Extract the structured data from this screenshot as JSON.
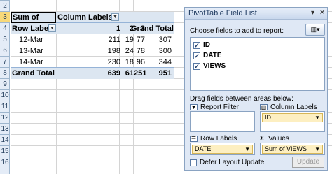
{
  "sheet": {
    "row_numbers": [
      "2",
      "3",
      "4",
      "5",
      "6",
      "7",
      "8",
      "9",
      "10",
      "11",
      "12",
      "13",
      "14",
      "15",
      "16"
    ],
    "pivot": {
      "value_field": "Sum of VIEWS",
      "column_labels": "Column Labels",
      "row_labels": "Row Labels",
      "column_ids": [
        "1",
        "2",
        "3"
      ],
      "grand_total_label": "Grand Total",
      "rows": [
        {
          "label": "12-Mar",
          "v1": "211",
          "v2": "19",
          "v3": "77",
          "total": "307"
        },
        {
          "label": "13-Mar",
          "v1": "198",
          "v2": "24",
          "v3": "78",
          "total": "300"
        },
        {
          "label": "14-Mar",
          "v1": "230",
          "v2": "18",
          "v3": "96",
          "total": "344"
        }
      ],
      "totals": {
        "label": "Grand Total",
        "v1": "639",
        "v2": "61",
        "v3": "251",
        "total": "951"
      }
    }
  },
  "pane": {
    "title": "PivotTable Field List",
    "choose_label": "Choose fields to add to report:",
    "fields": [
      {
        "name": "ID",
        "checked": true
      },
      {
        "name": "DATE",
        "checked": true
      },
      {
        "name": "VIEWS",
        "checked": true
      }
    ],
    "drag_label": "Drag fields between areas below:",
    "areas": {
      "report_filter": {
        "title": "Report Filter"
      },
      "column_labels": {
        "title": "Column Labels",
        "chip": "ID"
      },
      "row_labels": {
        "title": "Row Labels",
        "chip": "DATE"
      },
      "values": {
        "title": "Values",
        "chip": "Sum of VIEWS"
      }
    },
    "defer_label": "Defer Layout Update",
    "update_label": "Update"
  }
}
